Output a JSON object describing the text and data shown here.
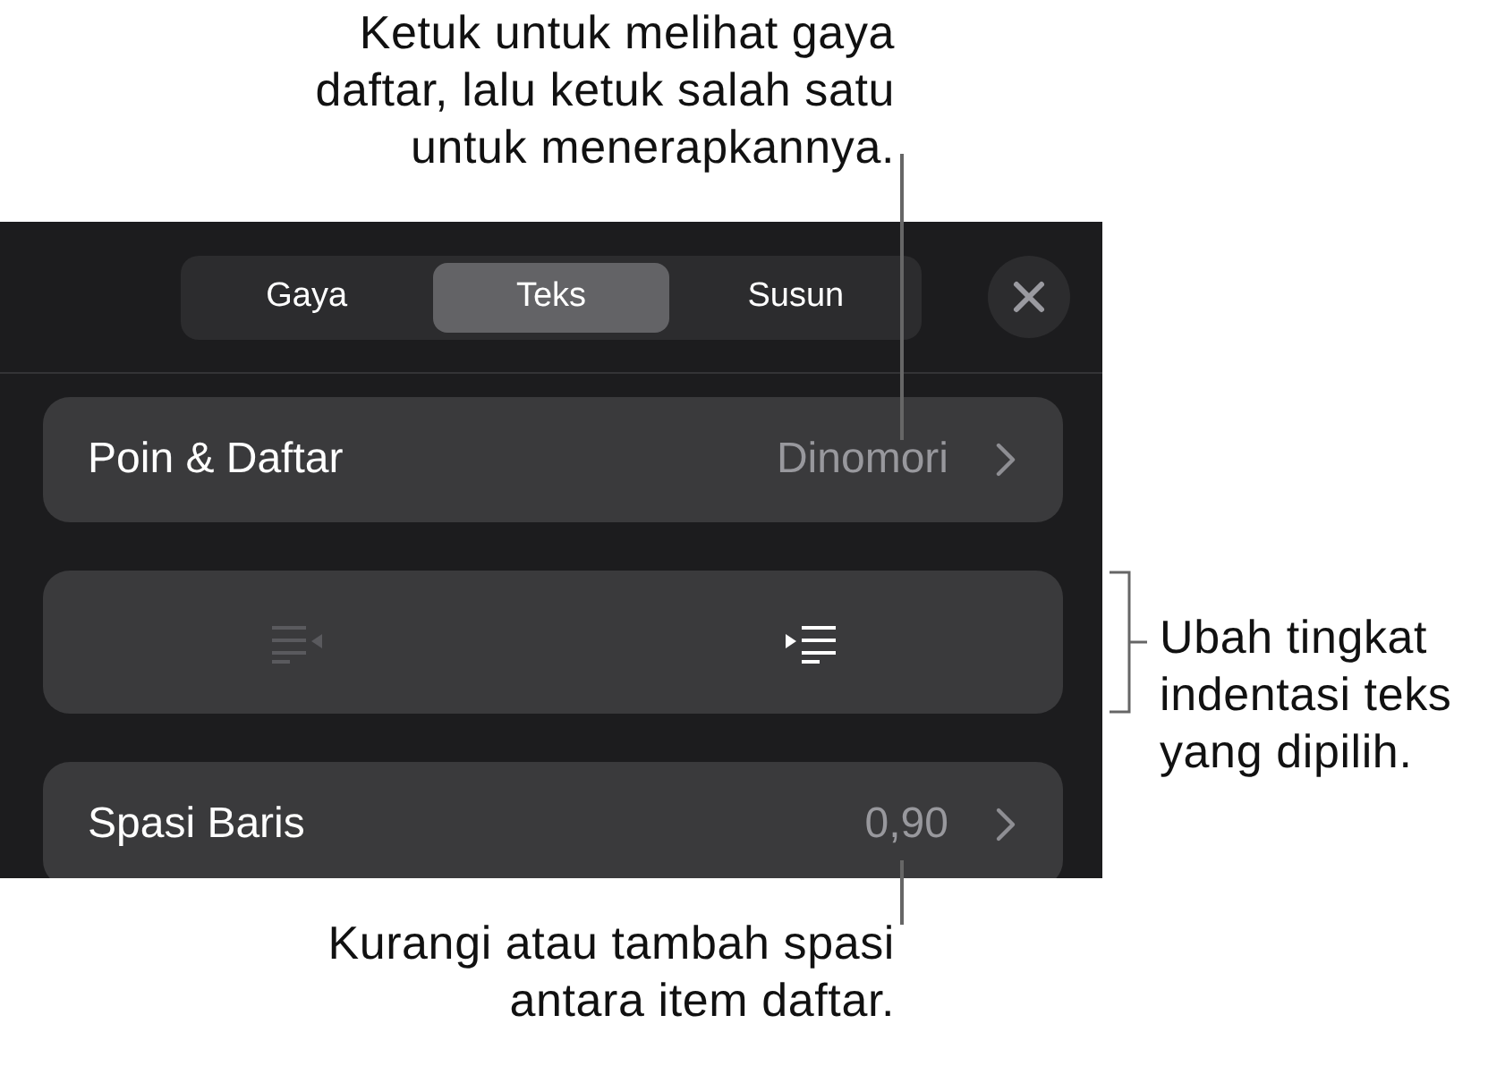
{
  "callouts": [
    {
      "kind": "top",
      "text": "Ketuk untuk melihat gaya daftar, lalu ketuk salah satu untuk menerapkannya."
    },
    {
      "kind": "right",
      "text": "Ubah tingkat indentasi teks yang dipilih."
    },
    {
      "kind": "bottom",
      "text": "Kurangi atau tambah spasi antara item daftar."
    }
  ],
  "tabs": [
    {
      "label": "Gaya",
      "selected": false
    },
    {
      "label": "Teks",
      "selected": true
    },
    {
      "label": "Susun",
      "selected": false
    }
  ],
  "rows": [
    {
      "kind": "value",
      "label": "Poin & Daftar",
      "value": "Dinomori"
    },
    {
      "kind": "indent",
      "buttons": [
        {
          "kind": "decrease",
          "disabled": true
        },
        {
          "kind": "increase",
          "disabled": false
        }
      ]
    },
    {
      "kind": "value",
      "label": "Spasi Baris",
      "value": "0,90"
    }
  ]
}
